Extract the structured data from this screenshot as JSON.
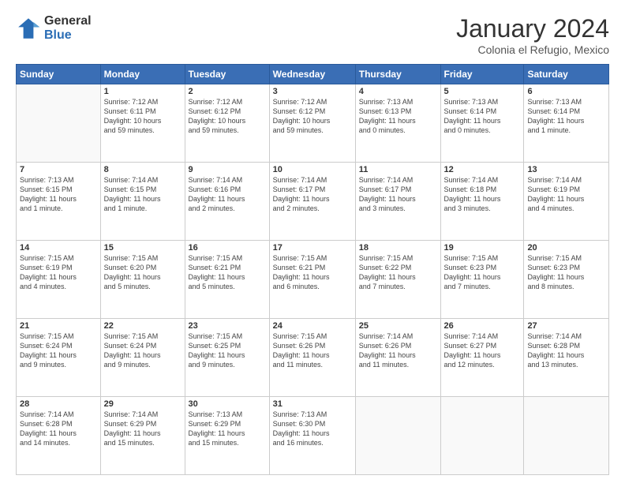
{
  "header": {
    "logo_general": "General",
    "logo_blue": "Blue",
    "month_title": "January 2024",
    "location": "Colonia el Refugio, Mexico"
  },
  "days_of_week": [
    "Sunday",
    "Monday",
    "Tuesday",
    "Wednesday",
    "Thursday",
    "Friday",
    "Saturday"
  ],
  "weeks": [
    [
      {
        "num": "",
        "info": ""
      },
      {
        "num": "1",
        "info": "Sunrise: 7:12 AM\nSunset: 6:11 PM\nDaylight: 10 hours\nand 59 minutes."
      },
      {
        "num": "2",
        "info": "Sunrise: 7:12 AM\nSunset: 6:12 PM\nDaylight: 10 hours\nand 59 minutes."
      },
      {
        "num": "3",
        "info": "Sunrise: 7:12 AM\nSunset: 6:12 PM\nDaylight: 10 hours\nand 59 minutes."
      },
      {
        "num": "4",
        "info": "Sunrise: 7:13 AM\nSunset: 6:13 PM\nDaylight: 11 hours\nand 0 minutes."
      },
      {
        "num": "5",
        "info": "Sunrise: 7:13 AM\nSunset: 6:14 PM\nDaylight: 11 hours\nand 0 minutes."
      },
      {
        "num": "6",
        "info": "Sunrise: 7:13 AM\nSunset: 6:14 PM\nDaylight: 11 hours\nand 1 minute."
      }
    ],
    [
      {
        "num": "7",
        "info": "Sunrise: 7:13 AM\nSunset: 6:15 PM\nDaylight: 11 hours\nand 1 minute."
      },
      {
        "num": "8",
        "info": "Sunrise: 7:14 AM\nSunset: 6:15 PM\nDaylight: 11 hours\nand 1 minute."
      },
      {
        "num": "9",
        "info": "Sunrise: 7:14 AM\nSunset: 6:16 PM\nDaylight: 11 hours\nand 2 minutes."
      },
      {
        "num": "10",
        "info": "Sunrise: 7:14 AM\nSunset: 6:17 PM\nDaylight: 11 hours\nand 2 minutes."
      },
      {
        "num": "11",
        "info": "Sunrise: 7:14 AM\nSunset: 6:17 PM\nDaylight: 11 hours\nand 3 minutes."
      },
      {
        "num": "12",
        "info": "Sunrise: 7:14 AM\nSunset: 6:18 PM\nDaylight: 11 hours\nand 3 minutes."
      },
      {
        "num": "13",
        "info": "Sunrise: 7:14 AM\nSunset: 6:19 PM\nDaylight: 11 hours\nand 4 minutes."
      }
    ],
    [
      {
        "num": "14",
        "info": "Sunrise: 7:15 AM\nSunset: 6:19 PM\nDaylight: 11 hours\nand 4 minutes."
      },
      {
        "num": "15",
        "info": "Sunrise: 7:15 AM\nSunset: 6:20 PM\nDaylight: 11 hours\nand 5 minutes."
      },
      {
        "num": "16",
        "info": "Sunrise: 7:15 AM\nSunset: 6:21 PM\nDaylight: 11 hours\nand 5 minutes."
      },
      {
        "num": "17",
        "info": "Sunrise: 7:15 AM\nSunset: 6:21 PM\nDaylight: 11 hours\nand 6 minutes."
      },
      {
        "num": "18",
        "info": "Sunrise: 7:15 AM\nSunset: 6:22 PM\nDaylight: 11 hours\nand 7 minutes."
      },
      {
        "num": "19",
        "info": "Sunrise: 7:15 AM\nSunset: 6:23 PM\nDaylight: 11 hours\nand 7 minutes."
      },
      {
        "num": "20",
        "info": "Sunrise: 7:15 AM\nSunset: 6:23 PM\nDaylight: 11 hours\nand 8 minutes."
      }
    ],
    [
      {
        "num": "21",
        "info": "Sunrise: 7:15 AM\nSunset: 6:24 PM\nDaylight: 11 hours\nand 9 minutes."
      },
      {
        "num": "22",
        "info": "Sunrise: 7:15 AM\nSunset: 6:24 PM\nDaylight: 11 hours\nand 9 minutes."
      },
      {
        "num": "23",
        "info": "Sunrise: 7:15 AM\nSunset: 6:25 PM\nDaylight: 11 hours\nand 9 minutes."
      },
      {
        "num": "24",
        "info": "Sunrise: 7:15 AM\nSunset: 6:26 PM\nDaylight: 11 hours\nand 11 minutes."
      },
      {
        "num": "25",
        "info": "Sunrise: 7:14 AM\nSunset: 6:26 PM\nDaylight: 11 hours\nand 11 minutes."
      },
      {
        "num": "26",
        "info": "Sunrise: 7:14 AM\nSunset: 6:27 PM\nDaylight: 11 hours\nand 12 minutes."
      },
      {
        "num": "27",
        "info": "Sunrise: 7:14 AM\nSunset: 6:28 PM\nDaylight: 11 hours\nand 13 minutes."
      }
    ],
    [
      {
        "num": "28",
        "info": "Sunrise: 7:14 AM\nSunset: 6:28 PM\nDaylight: 11 hours\nand 14 minutes."
      },
      {
        "num": "29",
        "info": "Sunrise: 7:14 AM\nSunset: 6:29 PM\nDaylight: 11 hours\nand 15 minutes."
      },
      {
        "num": "30",
        "info": "Sunrise: 7:13 AM\nSunset: 6:29 PM\nDaylight: 11 hours\nand 15 minutes."
      },
      {
        "num": "31",
        "info": "Sunrise: 7:13 AM\nSunset: 6:30 PM\nDaylight: 11 hours\nand 16 minutes."
      },
      {
        "num": "",
        "info": ""
      },
      {
        "num": "",
        "info": ""
      },
      {
        "num": "",
        "info": ""
      }
    ]
  ]
}
